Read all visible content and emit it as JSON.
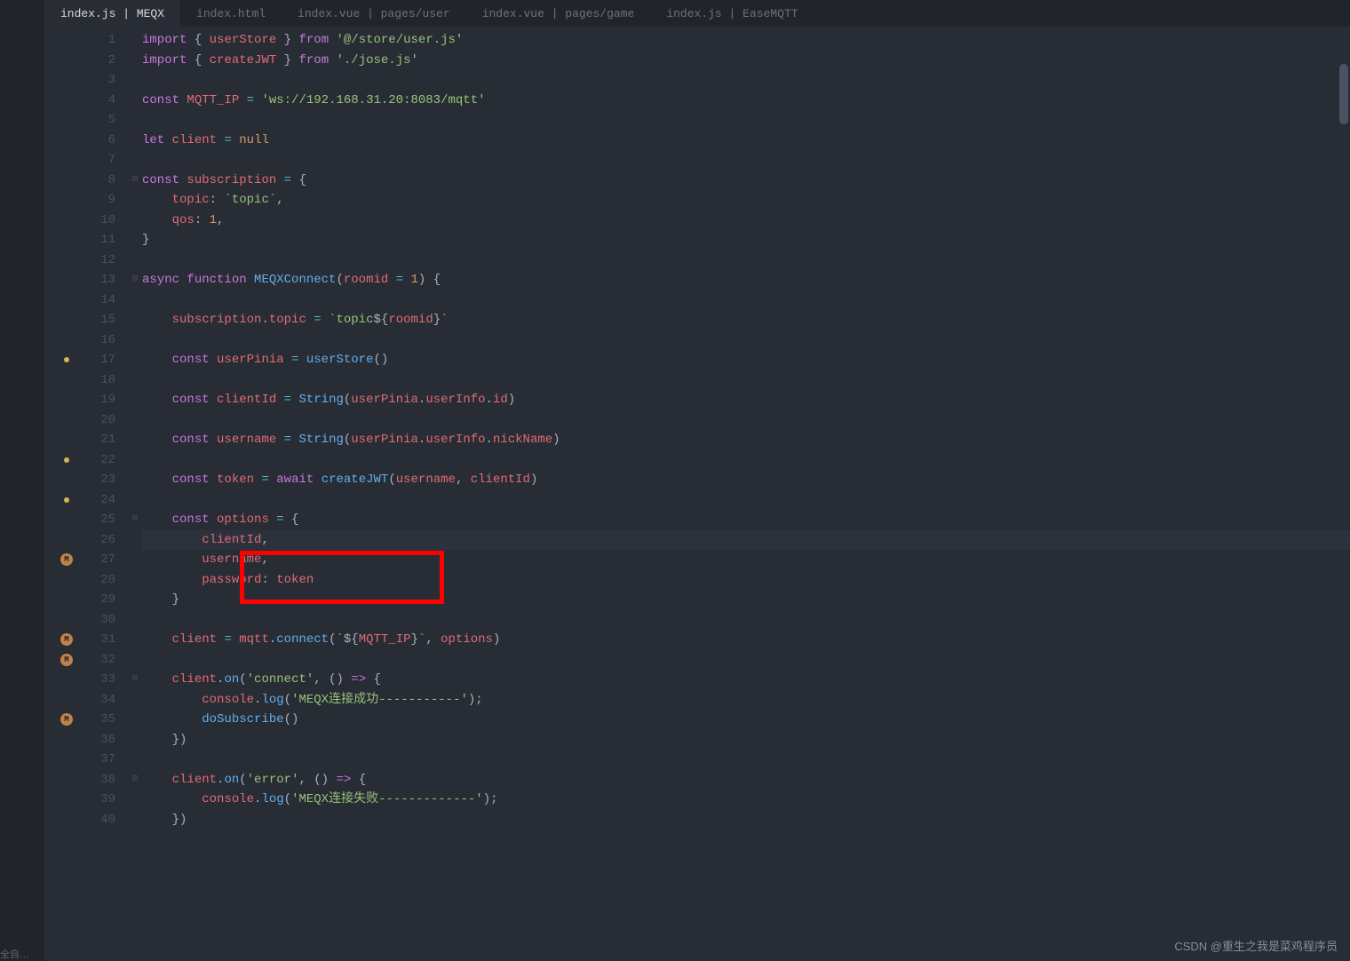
{
  "tabs": [
    {
      "label": "index.js | MEQX",
      "active": true
    },
    {
      "label": "index.html",
      "active": false
    },
    {
      "label": "index.vue | pages/user",
      "active": false
    },
    {
      "label": "index.vue | pages/game",
      "active": false
    },
    {
      "label": "index.js | EaseMQTT",
      "active": false
    }
  ],
  "gutter_markers": {
    "17": "dot",
    "22": "dot",
    "24": "dot",
    "27": "M",
    "31": "M",
    "32": "M",
    "35": "M"
  },
  "fold_markers": {
    "8": "⊟",
    "13": "⊟",
    "25": "⊟",
    "33": "⊟",
    "38": "⊟"
  },
  "highlighted_line": 26,
  "code_lines": [
    {
      "n": 1,
      "tokens": [
        [
          "kw",
          "import"
        ],
        [
          "punc",
          " { "
        ],
        [
          "var",
          "userStore"
        ],
        [
          "punc",
          " } "
        ],
        [
          "kw",
          "from"
        ],
        [
          "punc",
          " "
        ],
        [
          "str",
          "'@/store/user.js'"
        ]
      ]
    },
    {
      "n": 2,
      "tokens": [
        [
          "kw",
          "import"
        ],
        [
          "punc",
          " { "
        ],
        [
          "var",
          "createJWT"
        ],
        [
          "punc",
          " } "
        ],
        [
          "kw",
          "from"
        ],
        [
          "punc",
          " "
        ],
        [
          "str",
          "'./jose.js'"
        ]
      ]
    },
    {
      "n": 3,
      "tokens": []
    },
    {
      "n": 4,
      "tokens": [
        [
          "kw",
          "const"
        ],
        [
          "punc",
          " "
        ],
        [
          "var",
          "MQTT_IP"
        ],
        [
          "punc",
          " "
        ],
        [
          "op",
          "="
        ],
        [
          "punc",
          " "
        ],
        [
          "str",
          "'ws://192.168.31.20:8083/mqtt'"
        ]
      ]
    },
    {
      "n": 5,
      "tokens": []
    },
    {
      "n": 6,
      "tokens": [
        [
          "kw",
          "let"
        ],
        [
          "punc",
          " "
        ],
        [
          "var",
          "client"
        ],
        [
          "punc",
          " "
        ],
        [
          "op",
          "="
        ],
        [
          "punc",
          " "
        ],
        [
          "const",
          "null"
        ]
      ]
    },
    {
      "n": 7,
      "tokens": []
    },
    {
      "n": 8,
      "tokens": [
        [
          "kw",
          "const"
        ],
        [
          "punc",
          " "
        ],
        [
          "var",
          "subscription"
        ],
        [
          "punc",
          " "
        ],
        [
          "op",
          "="
        ],
        [
          "punc",
          " {"
        ]
      ]
    },
    {
      "n": 9,
      "tokens": [
        [
          "plain",
          "    "
        ],
        [
          "prop",
          "topic"
        ],
        [
          "punc",
          ": "
        ],
        [
          "tmpl",
          "`topic`"
        ],
        [
          "punc",
          ","
        ]
      ]
    },
    {
      "n": 10,
      "tokens": [
        [
          "plain",
          "    "
        ],
        [
          "prop",
          "qos"
        ],
        [
          "punc",
          ": "
        ],
        [
          "num",
          "1"
        ],
        [
          "punc",
          ","
        ]
      ]
    },
    {
      "n": 11,
      "tokens": [
        [
          "punc",
          "}"
        ]
      ]
    },
    {
      "n": 12,
      "tokens": []
    },
    {
      "n": 13,
      "tokens": [
        [
          "kw",
          "async"
        ],
        [
          "punc",
          " "
        ],
        [
          "kw",
          "function"
        ],
        [
          "punc",
          " "
        ],
        [
          "fn",
          "MEQXConnect"
        ],
        [
          "punc",
          "("
        ],
        [
          "var",
          "roomid"
        ],
        [
          "punc",
          " "
        ],
        [
          "op",
          "="
        ],
        [
          "punc",
          " "
        ],
        [
          "num",
          "1"
        ],
        [
          "punc",
          ") {"
        ]
      ]
    },
    {
      "n": 14,
      "tokens": []
    },
    {
      "n": 15,
      "tokens": [
        [
          "plain",
          "    "
        ],
        [
          "var",
          "subscription"
        ],
        [
          "punc",
          "."
        ],
        [
          "prop",
          "topic"
        ],
        [
          "punc",
          " "
        ],
        [
          "op",
          "="
        ],
        [
          "punc",
          " "
        ],
        [
          "tmpl",
          "`topic"
        ],
        [
          "punc",
          "${"
        ],
        [
          "tmplvar",
          "roomid"
        ],
        [
          "punc",
          "}"
        ],
        [
          "tmpl",
          "`"
        ]
      ]
    },
    {
      "n": 16,
      "tokens": []
    },
    {
      "n": 17,
      "tokens": [
        [
          "plain",
          "    "
        ],
        [
          "kw",
          "const"
        ],
        [
          "punc",
          " "
        ],
        [
          "var",
          "userPinia"
        ],
        [
          "punc",
          " "
        ],
        [
          "op",
          "="
        ],
        [
          "punc",
          " "
        ],
        [
          "fn",
          "userStore"
        ],
        [
          "punc",
          "()"
        ]
      ]
    },
    {
      "n": 18,
      "tokens": []
    },
    {
      "n": 19,
      "tokens": [
        [
          "plain",
          "    "
        ],
        [
          "kw",
          "const"
        ],
        [
          "punc",
          " "
        ],
        [
          "var",
          "clientId"
        ],
        [
          "punc",
          " "
        ],
        [
          "op",
          "="
        ],
        [
          "punc",
          " "
        ],
        [
          "fn",
          "String"
        ],
        [
          "punc",
          "("
        ],
        [
          "var",
          "userPinia"
        ],
        [
          "punc",
          "."
        ],
        [
          "prop",
          "userInfo"
        ],
        [
          "punc",
          "."
        ],
        [
          "prop",
          "id"
        ],
        [
          "punc",
          ")"
        ]
      ]
    },
    {
      "n": 20,
      "tokens": []
    },
    {
      "n": 21,
      "tokens": [
        [
          "plain",
          "    "
        ],
        [
          "kw",
          "const"
        ],
        [
          "punc",
          " "
        ],
        [
          "var",
          "username"
        ],
        [
          "punc",
          " "
        ],
        [
          "op",
          "="
        ],
        [
          "punc",
          " "
        ],
        [
          "fn",
          "String"
        ],
        [
          "punc",
          "("
        ],
        [
          "var",
          "userPinia"
        ],
        [
          "punc",
          "."
        ],
        [
          "prop",
          "userInfo"
        ],
        [
          "punc",
          "."
        ],
        [
          "prop",
          "nickName"
        ],
        [
          "punc",
          ")"
        ]
      ]
    },
    {
      "n": 22,
      "tokens": []
    },
    {
      "n": 23,
      "tokens": [
        [
          "plain",
          "    "
        ],
        [
          "kw",
          "const"
        ],
        [
          "punc",
          " "
        ],
        [
          "var",
          "token"
        ],
        [
          "punc",
          " "
        ],
        [
          "op",
          "="
        ],
        [
          "punc",
          " "
        ],
        [
          "kw",
          "await"
        ],
        [
          "punc",
          " "
        ],
        [
          "fn",
          "createJWT"
        ],
        [
          "punc",
          "("
        ],
        [
          "var",
          "username"
        ],
        [
          "punc",
          ", "
        ],
        [
          "var",
          "clientId"
        ],
        [
          "punc",
          ")"
        ]
      ]
    },
    {
      "n": 24,
      "tokens": []
    },
    {
      "n": 25,
      "tokens": [
        [
          "plain",
          "    "
        ],
        [
          "kw",
          "const"
        ],
        [
          "punc",
          " "
        ],
        [
          "var",
          "options"
        ],
        [
          "punc",
          " "
        ],
        [
          "op",
          "="
        ],
        [
          "punc",
          " {"
        ]
      ]
    },
    {
      "n": 26,
      "tokens": [
        [
          "plain",
          "        "
        ],
        [
          "prop",
          "clientId"
        ],
        [
          "punc",
          ","
        ]
      ]
    },
    {
      "n": 27,
      "tokens": [
        [
          "plain",
          "        "
        ],
        [
          "prop",
          "username"
        ],
        [
          "punc",
          ","
        ]
      ]
    },
    {
      "n": 28,
      "tokens": [
        [
          "plain",
          "        "
        ],
        [
          "prop",
          "password"
        ],
        [
          "punc",
          ": "
        ],
        [
          "var",
          "token"
        ]
      ]
    },
    {
      "n": 29,
      "tokens": [
        [
          "plain",
          "    }"
        ]
      ]
    },
    {
      "n": 30,
      "tokens": []
    },
    {
      "n": 31,
      "tokens": [
        [
          "plain",
          "    "
        ],
        [
          "var",
          "client"
        ],
        [
          "punc",
          " "
        ],
        [
          "op",
          "="
        ],
        [
          "punc",
          " "
        ],
        [
          "var",
          "mqtt"
        ],
        [
          "punc",
          "."
        ],
        [
          "fn",
          "connect"
        ],
        [
          "punc",
          "("
        ],
        [
          "tmpl",
          "`"
        ],
        [
          "punc",
          "${"
        ],
        [
          "tmplvar",
          "MQTT_IP"
        ],
        [
          "punc",
          "}"
        ],
        [
          "tmpl",
          "`"
        ],
        [
          "punc",
          ", "
        ],
        [
          "var",
          "options"
        ],
        [
          "punc",
          ")"
        ]
      ]
    },
    {
      "n": 32,
      "tokens": []
    },
    {
      "n": 33,
      "tokens": [
        [
          "plain",
          "    "
        ],
        [
          "var",
          "client"
        ],
        [
          "punc",
          "."
        ],
        [
          "fn",
          "on"
        ],
        [
          "punc",
          "("
        ],
        [
          "str",
          "'connect'"
        ],
        [
          "punc",
          ", () "
        ],
        [
          "kw",
          "=>"
        ],
        [
          "punc",
          " {"
        ]
      ]
    },
    {
      "n": 34,
      "tokens": [
        [
          "plain",
          "        "
        ],
        [
          "var",
          "console"
        ],
        [
          "punc",
          "."
        ],
        [
          "fn",
          "log"
        ],
        [
          "punc",
          "("
        ],
        [
          "str",
          "'MEQX连接成功-----------'"
        ],
        [
          "punc",
          ");"
        ]
      ]
    },
    {
      "n": 35,
      "tokens": [
        [
          "plain",
          "        "
        ],
        [
          "fn",
          "doSubscribe"
        ],
        [
          "punc",
          "()"
        ]
      ]
    },
    {
      "n": 36,
      "tokens": [
        [
          "plain",
          "    })"
        ]
      ]
    },
    {
      "n": 37,
      "tokens": []
    },
    {
      "n": 38,
      "tokens": [
        [
          "plain",
          "    "
        ],
        [
          "var",
          "client"
        ],
        [
          "punc",
          "."
        ],
        [
          "fn",
          "on"
        ],
        [
          "punc",
          "("
        ],
        [
          "str",
          "'error'"
        ],
        [
          "punc",
          ", () "
        ],
        [
          "kw",
          "=>"
        ],
        [
          "punc",
          " {"
        ]
      ]
    },
    {
      "n": 39,
      "tokens": [
        [
          "plain",
          "        "
        ],
        [
          "var",
          "console"
        ],
        [
          "punc",
          "."
        ],
        [
          "fn",
          "log"
        ],
        [
          "punc",
          "("
        ],
        [
          "str",
          "'MEQX连接失败-------------'"
        ],
        [
          "punc",
          ");"
        ]
      ]
    },
    {
      "n": 40,
      "tokens": [
        [
          "plain",
          "    })"
        ]
      ]
    }
  ],
  "watermark": "CSDN @重生之我是菜鸡程序员",
  "corner_label": "全自…"
}
